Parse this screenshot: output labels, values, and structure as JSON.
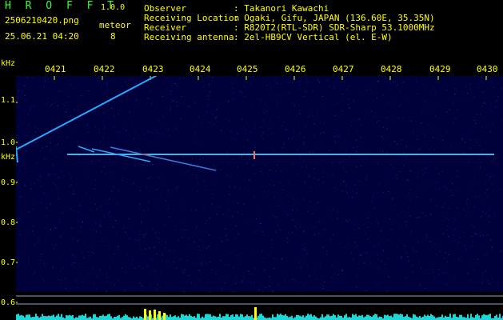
{
  "app": {
    "title": "H R O F F T",
    "version": "1.0.0"
  },
  "file": {
    "name": "2506210420.png",
    "datetime": "25.06.21 04:20"
  },
  "counter": {
    "label": "meteor",
    "value": "8"
  },
  "info": [
    {
      "key": "Observer",
      "value": ": Takanori Kawachi"
    },
    {
      "key": "Receiving Location",
      "value": ": Ogaki, Gifu, JAPAN (136.60E, 35.35N)"
    },
    {
      "key": "Receiver",
      "value": ": R820T2(RTL-SDR) SDR-Sharp 53.1000MHz"
    },
    {
      "key": "Receiving antenna",
      "value": ": 2el-HB9CV Vertical (el. E-W)"
    }
  ],
  "axes": {
    "y_unit": "kHz",
    "y_unit_right": "kHz",
    "y_ticks": [
      "1.1",
      "1.0",
      "0.9",
      "0.8",
      "0.7",
      "0.6"
    ],
    "x_ticks": [
      "0421",
      "0422",
      "0423",
      "0424",
      "0425",
      "0426",
      "0427",
      "0428",
      "0429",
      "0430"
    ]
  },
  "colors": {
    "background": "#00003a",
    "axis_text": "#ffff00",
    "header_green": "#33ff33",
    "signal": "#2aa8ff",
    "carrier": "#5ad0ff"
  }
}
